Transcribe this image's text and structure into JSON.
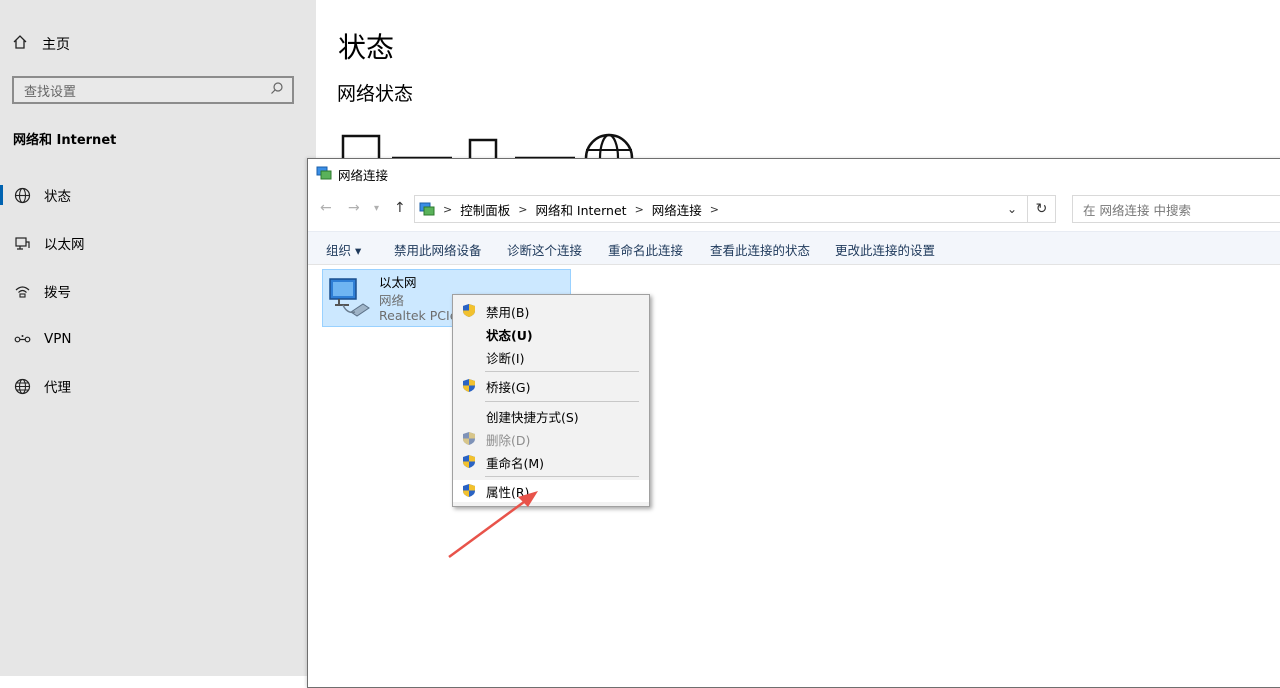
{
  "settings": {
    "home": "主页",
    "search_placeholder": "查找设置",
    "section": "网络和 Internet",
    "nav": [
      {
        "label": "状态",
        "icon": "globe-status-icon",
        "selected": true
      },
      {
        "label": "以太网",
        "icon": "ethernet-icon",
        "selected": false
      },
      {
        "label": "拨号",
        "icon": "dialup-icon",
        "selected": false
      },
      {
        "label": "VPN",
        "icon": "vpn-icon",
        "selected": false
      },
      {
        "label": "代理",
        "icon": "globe-icon",
        "selected": false
      }
    ],
    "page_title": "状态",
    "sub_title": "网络状态"
  },
  "explorer": {
    "title": "网络连接",
    "breadcrumb": [
      "控制面板",
      "网络和 Internet",
      "网络连接"
    ],
    "search_placeholder": "在 网络连接 中搜索",
    "commands": [
      "组织 ▾",
      "禁用此网络设备",
      "诊断这个连接",
      "重命名此连接",
      "查看此连接的状态",
      "更改此连接的设置"
    ],
    "connection": {
      "name": "以太网",
      "status": "网络",
      "device": "Realtek PCIe"
    }
  },
  "context_menu": {
    "items": [
      {
        "label": "禁用(B)",
        "shield": true,
        "bold": false,
        "disabled": false
      },
      {
        "label": "状态(U)",
        "shield": false,
        "bold": true,
        "disabled": false
      },
      {
        "label": "诊断(I)",
        "shield": false,
        "bold": false,
        "disabled": false
      },
      {
        "label": "桥接(G)",
        "shield": true,
        "bold": false,
        "disabled": false
      },
      {
        "label": "创建快捷方式(S)",
        "shield": false,
        "bold": false,
        "disabled": false
      },
      {
        "label": "删除(D)",
        "shield": true,
        "bold": false,
        "disabled": true
      },
      {
        "label": "重命名(M)",
        "shield": true,
        "bold": false,
        "disabled": false
      },
      {
        "label": "属性(R)",
        "shield": true,
        "bold": false,
        "disabled": false,
        "hovered": true
      }
    ]
  },
  "colors": {
    "accent": "#0063b1",
    "selection": "#cce8ff",
    "annotation_arrow": "#e8534a"
  }
}
